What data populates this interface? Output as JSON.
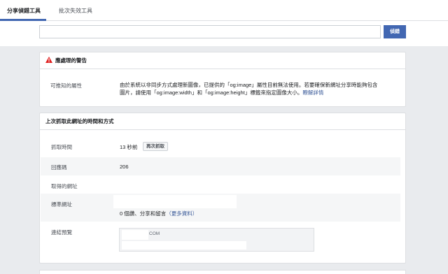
{
  "tabs": [
    {
      "label": "分享偵錯工具",
      "active": true
    },
    {
      "label": "批次失效工具",
      "active": false
    }
  ],
  "search": {
    "value": "",
    "placeholder": "",
    "button_label": "偵錯"
  },
  "warning_card": {
    "title": "應處理的警告",
    "icon": "warning-triangle-icon",
    "row": {
      "label": "可推知的屬性",
      "text": "由於系統以非同步方式處理新圖像，已提供的「og:image」屬性目前無法使用。若要確保新網址分享時能夠包含圖片，請使用「og:image:width」和「og:image:height」標籤來指定圖像大小。",
      "link": "瞭解詳情"
    }
  },
  "scrape_card": {
    "title": "上次抓取此網址的時間和方式",
    "rows": {
      "fetch_time": {
        "label": "抓取時間",
        "value": "13 秒前",
        "button": "再次抓取"
      },
      "response_code": {
        "label": "回應碼",
        "value": "206"
      },
      "fetched_url": {
        "label": "取得的網址",
        "value": ""
      },
      "canonical_url": {
        "label": "標準網址",
        "value": "0 個讚、分享和留言",
        "link": "（更多資料）"
      },
      "link_preview": {
        "label": "連結預覽",
        "domain": "COM"
      }
    }
  },
  "colors": {
    "accent": "#4267b2",
    "link": "#385898",
    "warning": "#e02020",
    "background": "#e9ebee"
  }
}
